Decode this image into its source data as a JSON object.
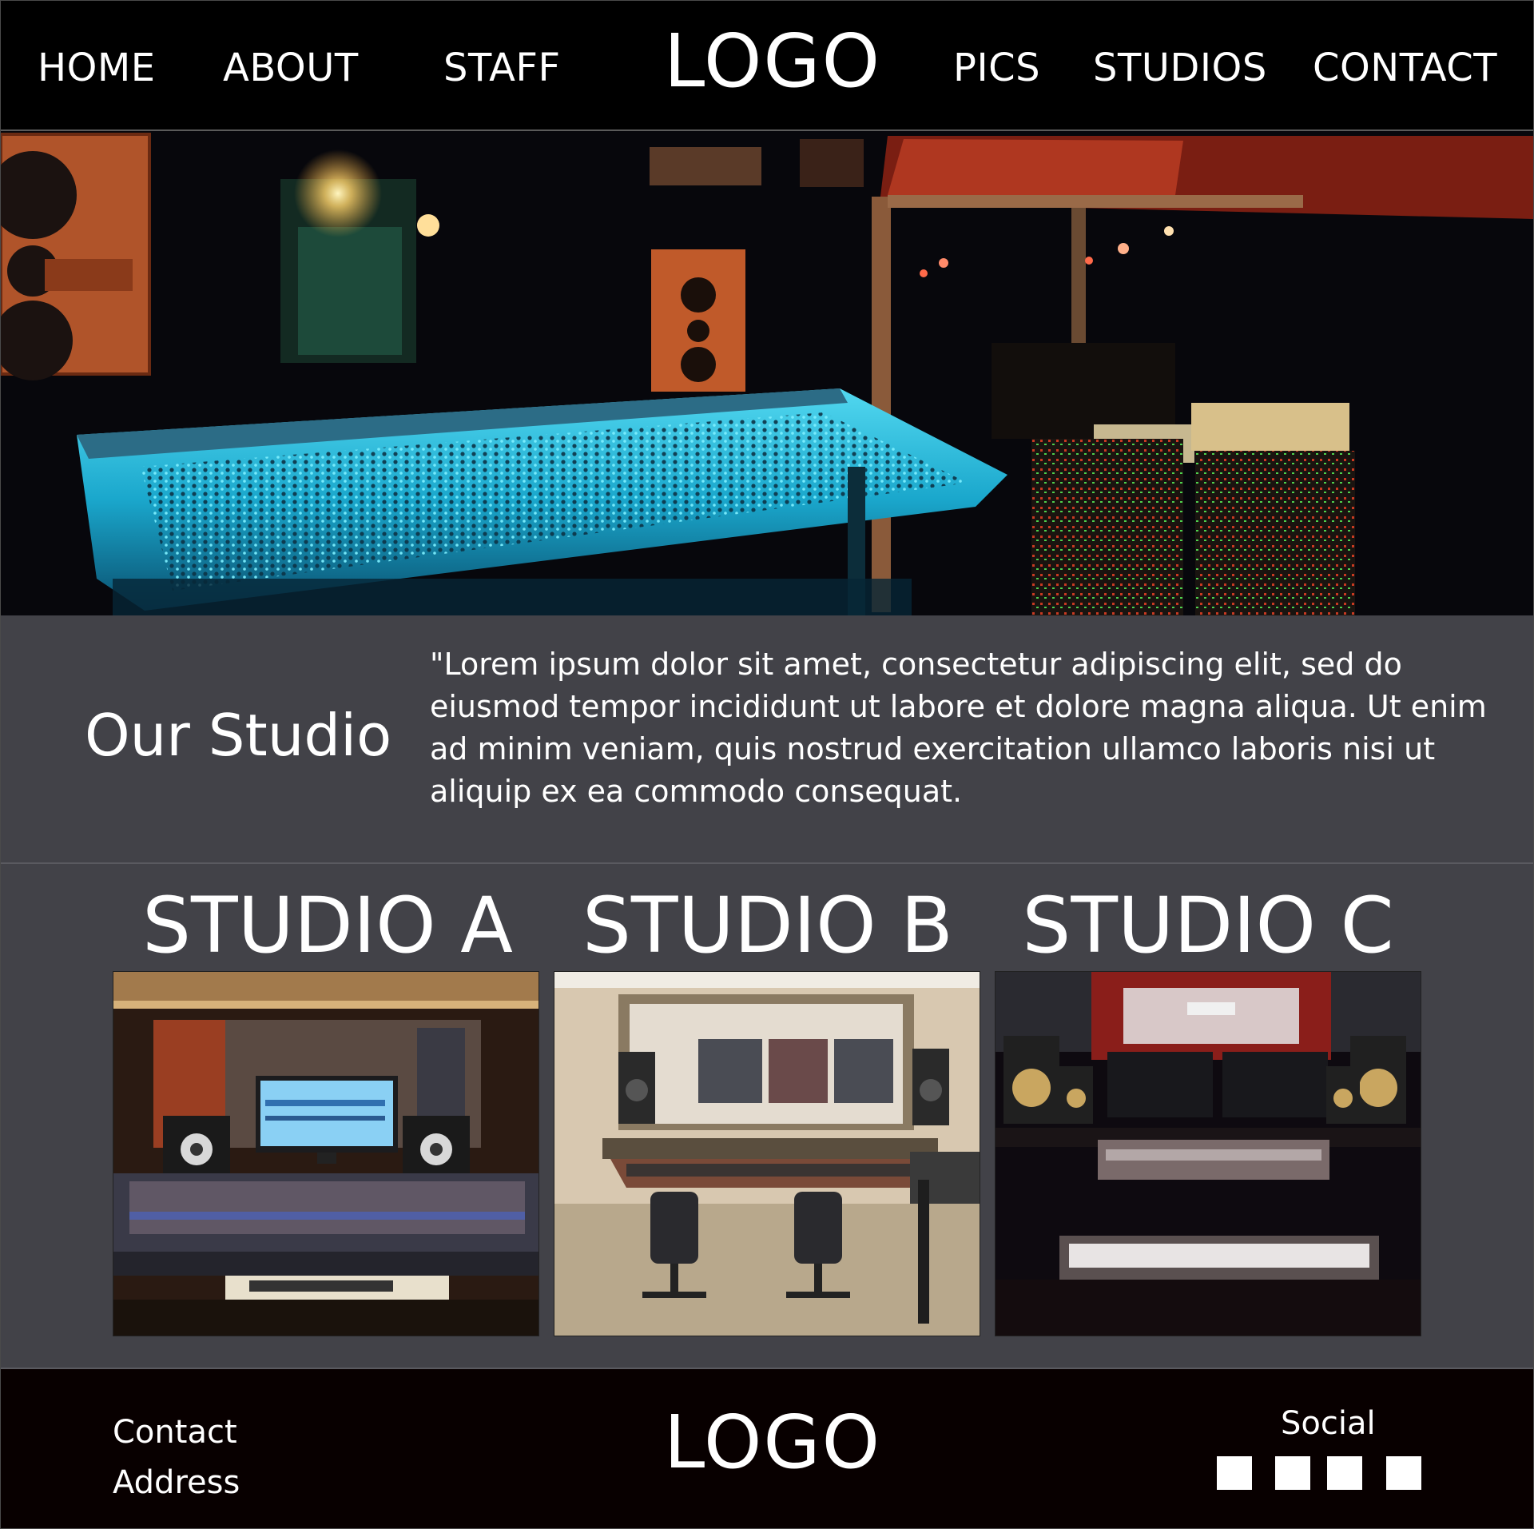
{
  "nav": {
    "items": [
      {
        "label": "HOME"
      },
      {
        "label": "ABOUT"
      },
      {
        "label": "STAFF"
      },
      {
        "label": "PICS"
      },
      {
        "label": "STUDIOS"
      },
      {
        "label": "CONTACT"
      }
    ],
    "logo": "LOGO"
  },
  "about": {
    "title": "Our Studio",
    "text": "\"Lorem ipsum dolor sit amet, consectetur adipiscing elit, sed do eiusmod tempor incididunt ut labore et dolore magna aliqua. Ut enim ad minim veniam, quis nostrud exercitation ullamco laboris nisi ut aliquip ex ea commodo consequat."
  },
  "studios": [
    {
      "title": "STUDIO A"
    },
    {
      "title": "STUDIO B"
    },
    {
      "title": "STUDIO C"
    }
  ],
  "footer": {
    "contact": "Contact",
    "address": "Address",
    "logo": "LOGO",
    "social": "Social"
  }
}
